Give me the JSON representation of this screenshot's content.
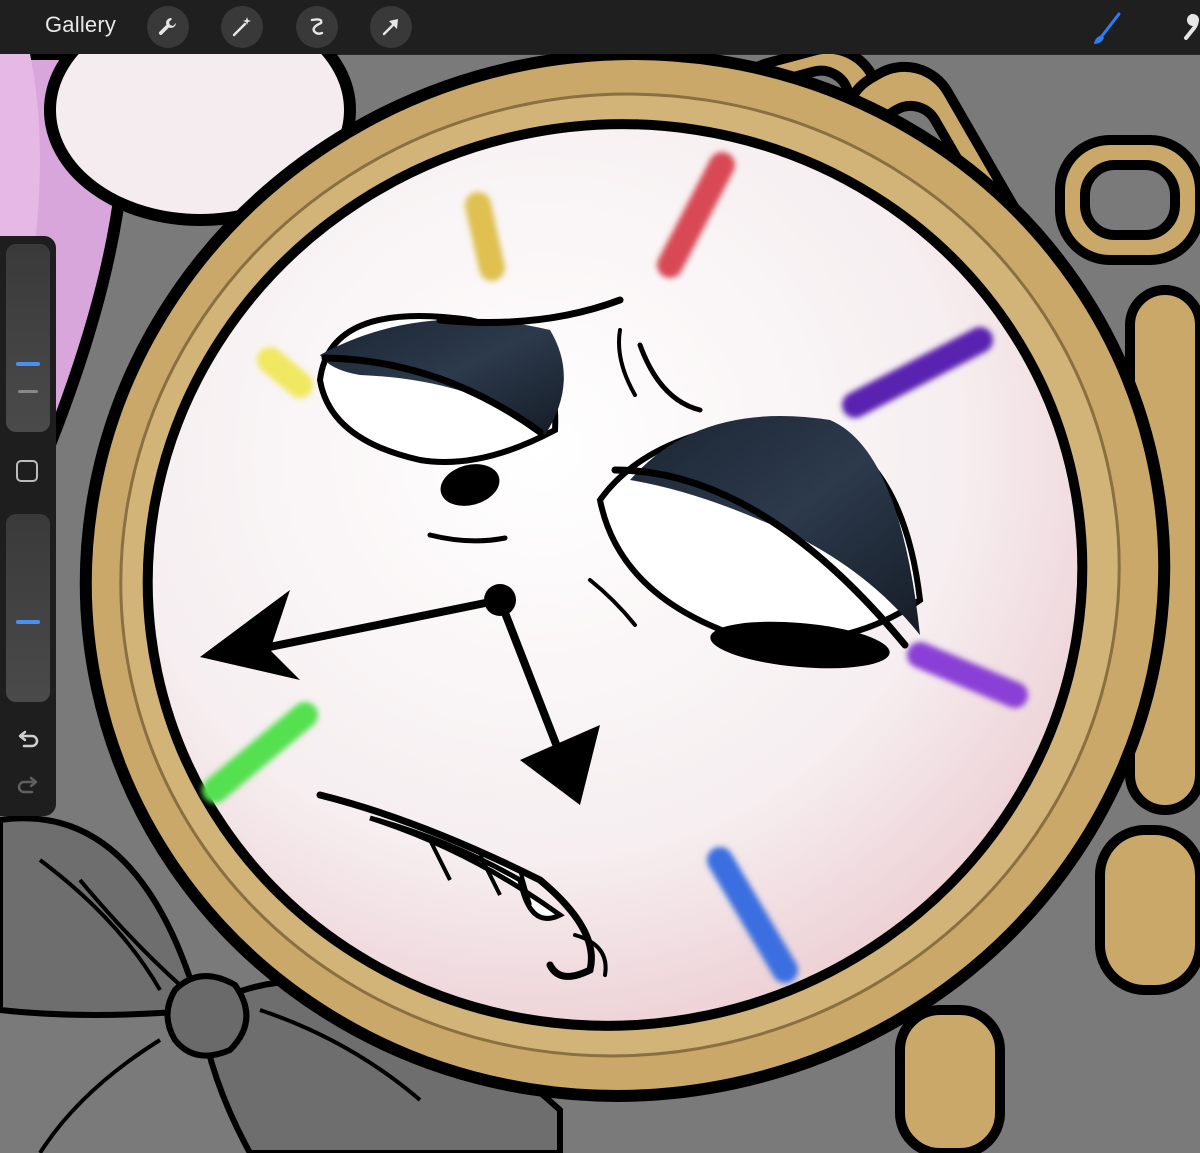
{
  "topbar": {
    "gallery_label": "Gallery",
    "tools": [
      "wrench-icon",
      "magic-wand-icon",
      "selection-icon",
      "transform-arrow-icon"
    ],
    "right_tools": [
      "brush-icon",
      "smudge-icon"
    ],
    "active_color": "#2f7df6"
  },
  "sidebar": {
    "brush_size_level": 0.55,
    "opacity_level": 0.55,
    "controls": [
      "brush-size-slider",
      "modify-button",
      "opacity-slider",
      "undo-button",
      "redo-button"
    ]
  },
  "colors": {
    "canvas_background": "#7a7a7a",
    "toolbar": "#1f1f1f",
    "gold": "#c9a86a",
    "clock_face": "#f6eef0",
    "hour_markers": [
      "#e0c050",
      "#d84a55",
      "#f0e860",
      "#5a23b0",
      "#8a3fd6",
      "#55e050",
      "#3a6ee0"
    ]
  }
}
